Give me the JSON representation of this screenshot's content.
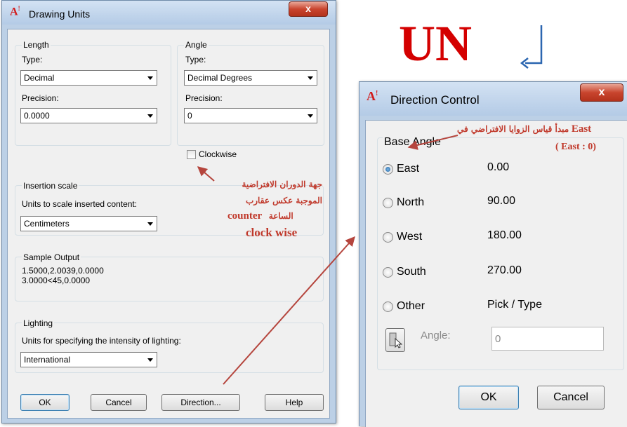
{
  "drawing_units": {
    "title": "Drawing Units",
    "close": "x",
    "length": {
      "group": "Length",
      "type_label": "Type:",
      "type_value": "Decimal",
      "precision_label": "Precision:",
      "precision_value": "0.0000"
    },
    "angle": {
      "group": "Angle",
      "type_label": "Type:",
      "type_value": "Decimal Degrees",
      "precision_label": "Precision:",
      "precision_value": "0",
      "clockwise": "Clockwise"
    },
    "insertion": {
      "group": "Insertion scale",
      "label": "Units to scale inserted content:",
      "value": "Centimeters"
    },
    "sample": {
      "group": "Sample Output",
      "line1": "1.5000,2.0039,0.0000",
      "line2": "3.0000<45,0.0000"
    },
    "lighting": {
      "group": "Lighting",
      "label": "Units for specifying the intensity of lighting:",
      "value": "International"
    },
    "buttons": {
      "ok": "OK",
      "cancel": "Cancel",
      "direction": "Direction...",
      "help": "Help"
    }
  },
  "direction_control": {
    "title": "Direction Control",
    "close": "x",
    "group": "Base Angle",
    "options": [
      {
        "label": "East",
        "value": "0.00"
      },
      {
        "label": "North",
        "value": "90.00"
      },
      {
        "label": "West",
        "value": "180.00"
      },
      {
        "label": "South",
        "value": "270.00"
      },
      {
        "label": "Other",
        "value": "Pick / Type"
      }
    ],
    "angle_label": "Angle:",
    "angle_value": "0",
    "buttons": {
      "ok": "OK",
      "cancel": "Cancel"
    }
  },
  "annotations": {
    "big_title": "UN",
    "note1_line1": "جهة الدوران الافتراضية",
    "note1_line2": "الموجبة عكس عقارب",
    "note1_line3_ar": "الساعة",
    "note1_line3_en": "counter",
    "note1_line4": "clock wise",
    "note2_ar": "مبدأ قياس الزوايا الافتراضي في",
    "note2_en": "East",
    "note2_line2": "( East : 0)"
  },
  "colors": {
    "annotation_red": "#c0392b",
    "title_red": "#d40000",
    "arrow": "#b5453d",
    "accent_blue": "#2b66b0"
  }
}
